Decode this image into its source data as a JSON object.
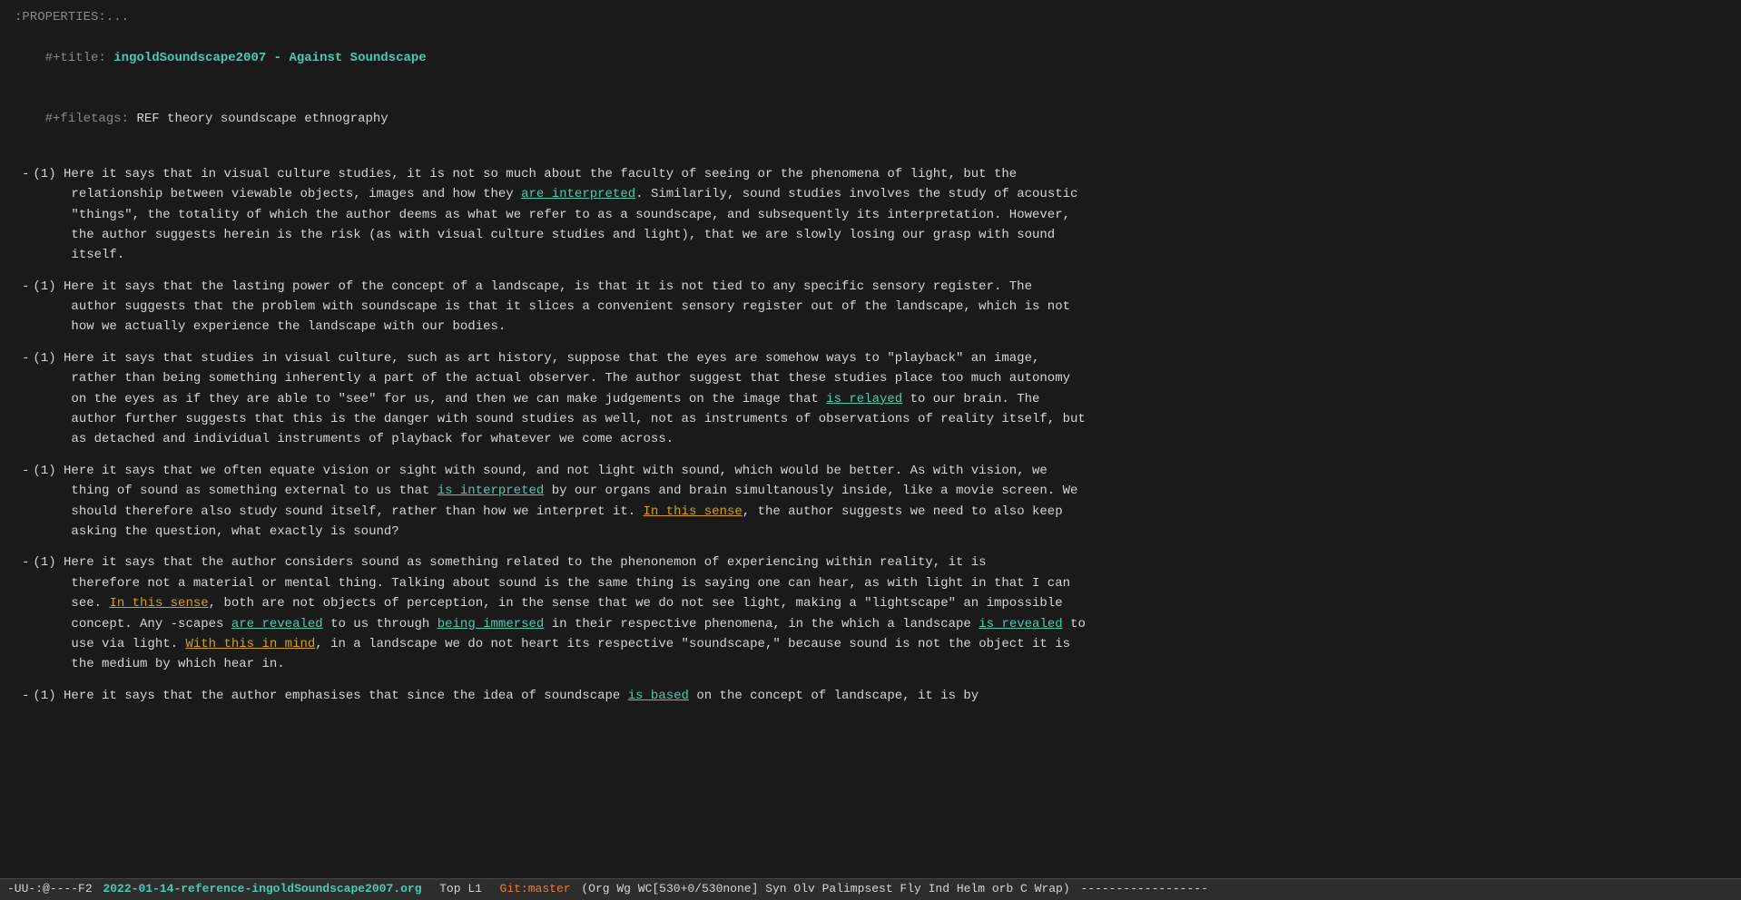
{
  "editor": {
    "properties_line": ":PROPERTIES:...",
    "title_label": "#+title: ",
    "title_value": "ingoldSoundscape2007 - Against Soundscape",
    "filetags_label": "#+filetags: ",
    "filetags_value": "REF theory soundscape ethnography"
  },
  "bullets": [
    {
      "id": 1,
      "parts": [
        {
          "type": "text",
          "content": "(1) Here it says that in visual culture studies, it is not so much about the faculty of seeing or the phenomena of light, but the\n     relationship between viewable objects, images and how they "
        },
        {
          "type": "link-cyan",
          "content": "are interpreted"
        },
        {
          "type": "text",
          "content": ". Similarily, sound studies involves the study of acoustic\n     \"things\", the totality of which the author deems as what we refer to as a soundscape, and subsequently its interpretation. However,\n     the author suggests herein is the risk (as with visual culture studies and light), that we are slowly losing our grasp with sound\n     itself."
        }
      ]
    },
    {
      "id": 2,
      "parts": [
        {
          "type": "text",
          "content": "(1) Here it says that the lasting power of the concept of a landscape, is that it is not tied to any specific sensory register. The\n     author suggests that the problem with soundscape is that it slices a convenient sensory register out of the landscape, which is not\n     how we actually experience the landscape with our bodies."
        }
      ]
    },
    {
      "id": 3,
      "parts": [
        {
          "type": "text",
          "content": "(1) Here it says that studies in visual culture, such as art history, suppose that the eyes are somehow ways to \"playback\" an image,\n     rather than being something inherently a part of the actual observer. The author suggest that these studies place too much autonomy\n     on the eyes as if they are able to \"see\" for us, and then we can make judgements on the image that "
        },
        {
          "type": "link-cyan",
          "content": "is relayed"
        },
        {
          "type": "text",
          "content": " to our brain. The\n     author further suggests that this is the danger with sound studies as well, not as instruments of observations of reality itself, but\n     as detached and individual instruments of playback for whatever we come across."
        }
      ]
    },
    {
      "id": 4,
      "parts": [
        {
          "type": "text",
          "content": "(1) Here it says that we often equate vision or sight with sound, and not light with sound, which would be better. As with vision, we\n     thing of sound as something external to us that "
        },
        {
          "type": "link-cyan",
          "content": "is interpreted"
        },
        {
          "type": "text",
          "content": " by our organs and brain simultanously inside, like a movie screen. We\n     should therefore also study sound itself, rather than how we interpret it. "
        },
        {
          "type": "link-yellow",
          "content": "In this sense"
        },
        {
          "type": "text",
          "content": ", the author suggests we need to also keep\n     asking the question, what exactly is sound?"
        }
      ]
    },
    {
      "id": 5,
      "parts": [
        {
          "type": "text",
          "content": "(1) Here it says that the author considers sound as something related to the phenonemon of experiencing within reality, it is\n     therefore not a material or mental thing. Talking about sound is the same thing is saying one can hear, as with light in that I can\n     see. "
        },
        {
          "type": "link-yellow",
          "content": "In this sense"
        },
        {
          "type": "text",
          "content": ", both are not objects of perception, in the sense that we do not see light, making a \"lightscape\" an impossible\n     concept. Any -scapes "
        },
        {
          "type": "link-cyan",
          "content": "are revealed"
        },
        {
          "type": "text",
          "content": " to us through "
        },
        {
          "type": "link-cyan",
          "content": "being immersed"
        },
        {
          "type": "text",
          "content": " in their respective phenomena, in the which a landscape "
        },
        {
          "type": "link-cyan",
          "content": "is revealed"
        },
        {
          "type": "text",
          "content": " to\n     use via light. "
        },
        {
          "type": "link-yellow",
          "content": "With this in mind"
        },
        {
          "type": "text",
          "content": ", in a landscape we do not heart its respective \"soundscape,\" because sound is not the object it is\n     the medium by which hear in."
        }
      ]
    },
    {
      "id": 6,
      "parts": [
        {
          "type": "text",
          "content": "(1) Here it says that the author emphasises that since the idea of soundscape "
        },
        {
          "type": "link-cyan",
          "content": "is based"
        },
        {
          "type": "text",
          "content": " on the concept of landscape, it is by"
        }
      ]
    }
  ],
  "status_bar": {
    "mode": "-UU-:@----F2",
    "filename": "2022-01-14-reference-ingoldSoundscape2007.org",
    "position": "Top L1",
    "branch": "Git:master",
    "info": "(Org Wg WC[530+0/530none] Syn Olv Palimpsest Fly Ind Helm orb C Wrap)",
    "dashes_left": "  ",
    "dashes_right": "------------------"
  }
}
